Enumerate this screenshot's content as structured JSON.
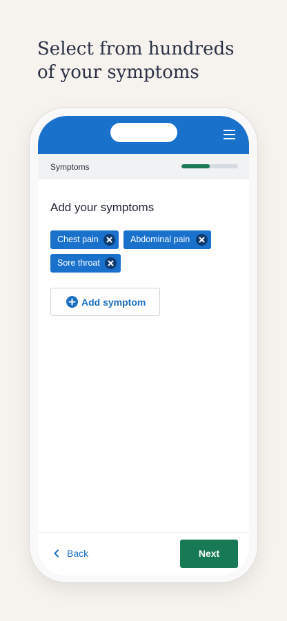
{
  "headline": {
    "line1": "Select from hundreds",
    "line2": "of your symptoms"
  },
  "app": {
    "menu_icon": "hamburger-menu-icon",
    "step_title": "Symptoms",
    "progress": 0.5,
    "progress_color": "#1a7a56",
    "brand_color": "#1971cc",
    "section_title": "Add your symptoms",
    "tags": [
      {
        "label": "Chest pain",
        "remove_icon": "close-icon"
      },
      {
        "label": "Abdominal pain",
        "remove_icon": "close-icon"
      },
      {
        "label": "Sore throat",
        "remove_icon": "close-icon"
      }
    ],
    "add_button": {
      "label": "Add symptom",
      "icon": "plus-circle-icon"
    },
    "footer": {
      "back_label": "Back",
      "back_icon": "chevron-left-icon",
      "next_label": "Next"
    }
  }
}
